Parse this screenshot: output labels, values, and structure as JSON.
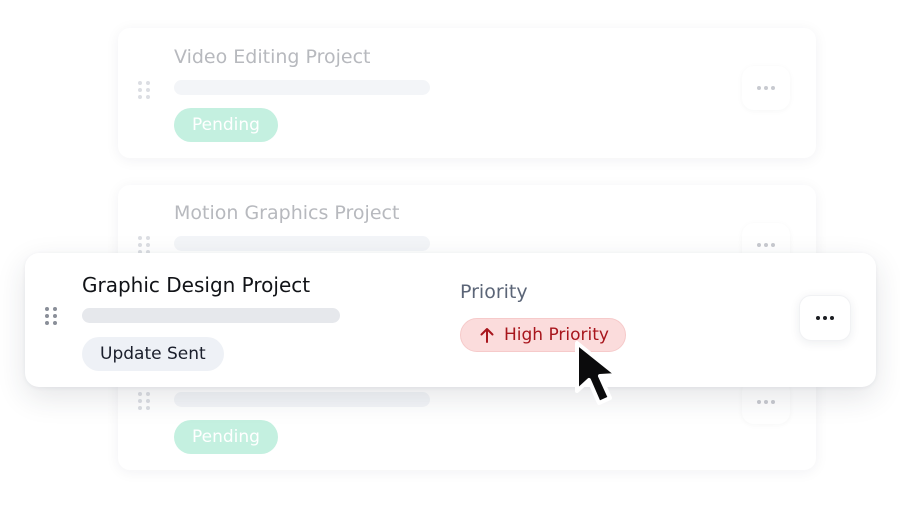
{
  "tasks": [
    {
      "title": "Video Editing Project",
      "status": "Pending"
    },
    {
      "title": "Motion Graphics Project"
    },
    {
      "title": "Graphic Design Project",
      "status": "Update Sent",
      "priority_label": "Priority",
      "priority_value": "High Priority"
    },
    {
      "status": "Pending"
    }
  ],
  "icons": {
    "drag": "drag-handle-icon",
    "more": "more-horizontal-icon",
    "priority": "arrow-up-icon",
    "cursor": "mouse-pointer-icon"
  },
  "colors": {
    "pending_bg": "#c4f0e0",
    "priority_bg": "#fbdcdc",
    "priority_text": "#a8151c",
    "status_bg": "#eef1f6"
  }
}
